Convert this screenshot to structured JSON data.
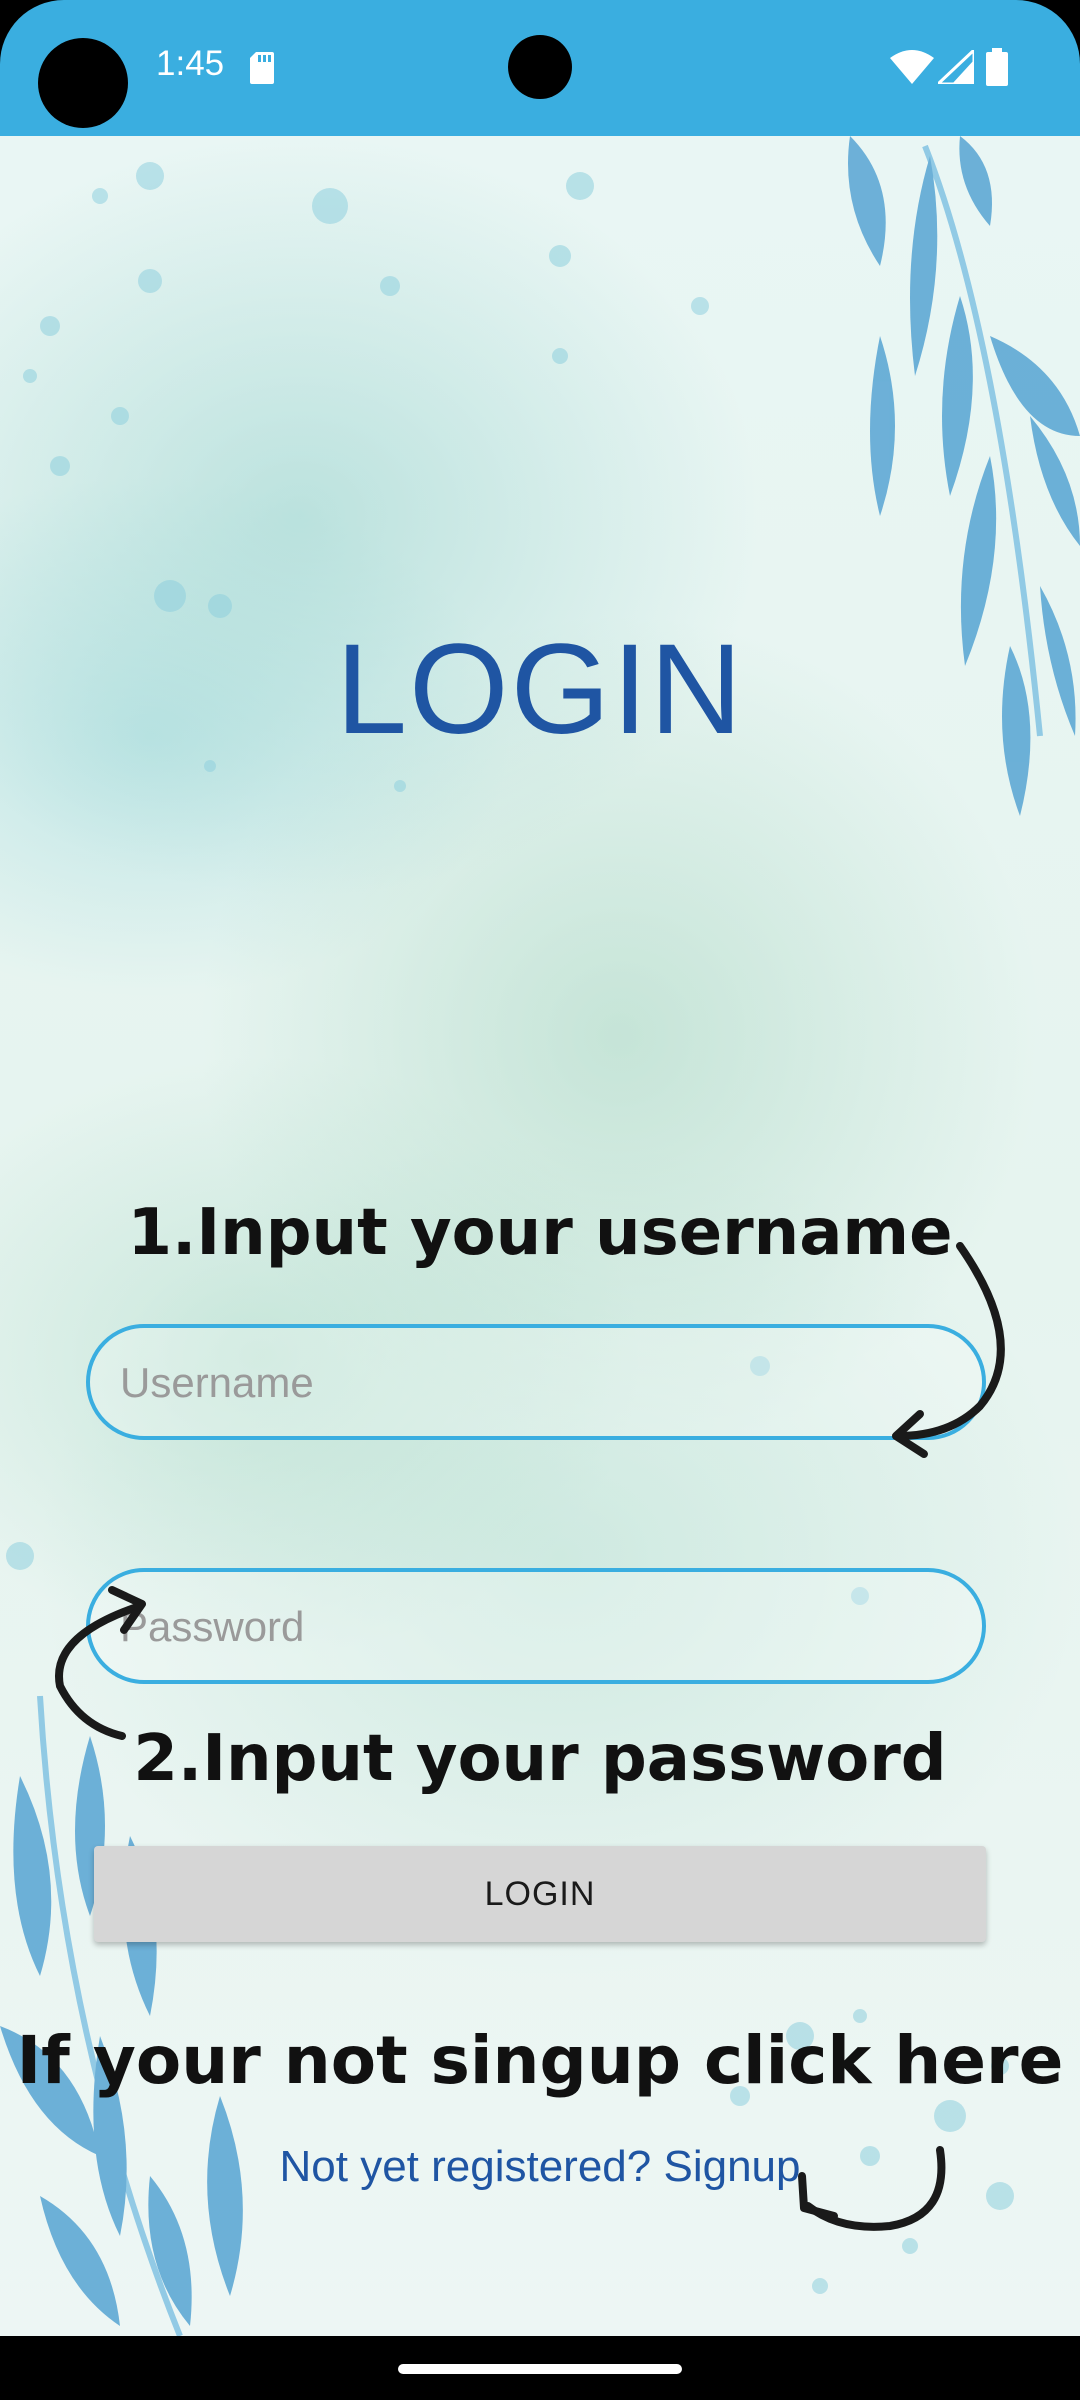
{
  "status_bar": {
    "time": "1:45",
    "background_color": "#3aaee0"
  },
  "login_screen": {
    "title": "LOGIN",
    "username_hint": "1.Input your username",
    "username_placeholder": "Username",
    "password_placeholder": "Password",
    "password_hint": "2.Input your password",
    "login_button_label": "LOGIN",
    "signup_hint": "If your not singup click here",
    "signup_link": "Not yet registered? Signup"
  },
  "colors": {
    "accent": "#3aaee0",
    "title": "#1f55a3",
    "button": "#d6d6d6"
  },
  "icons": [
    "sd-card-icon",
    "wifi-icon",
    "signal-icon",
    "battery-icon",
    "arrow-icon"
  ]
}
